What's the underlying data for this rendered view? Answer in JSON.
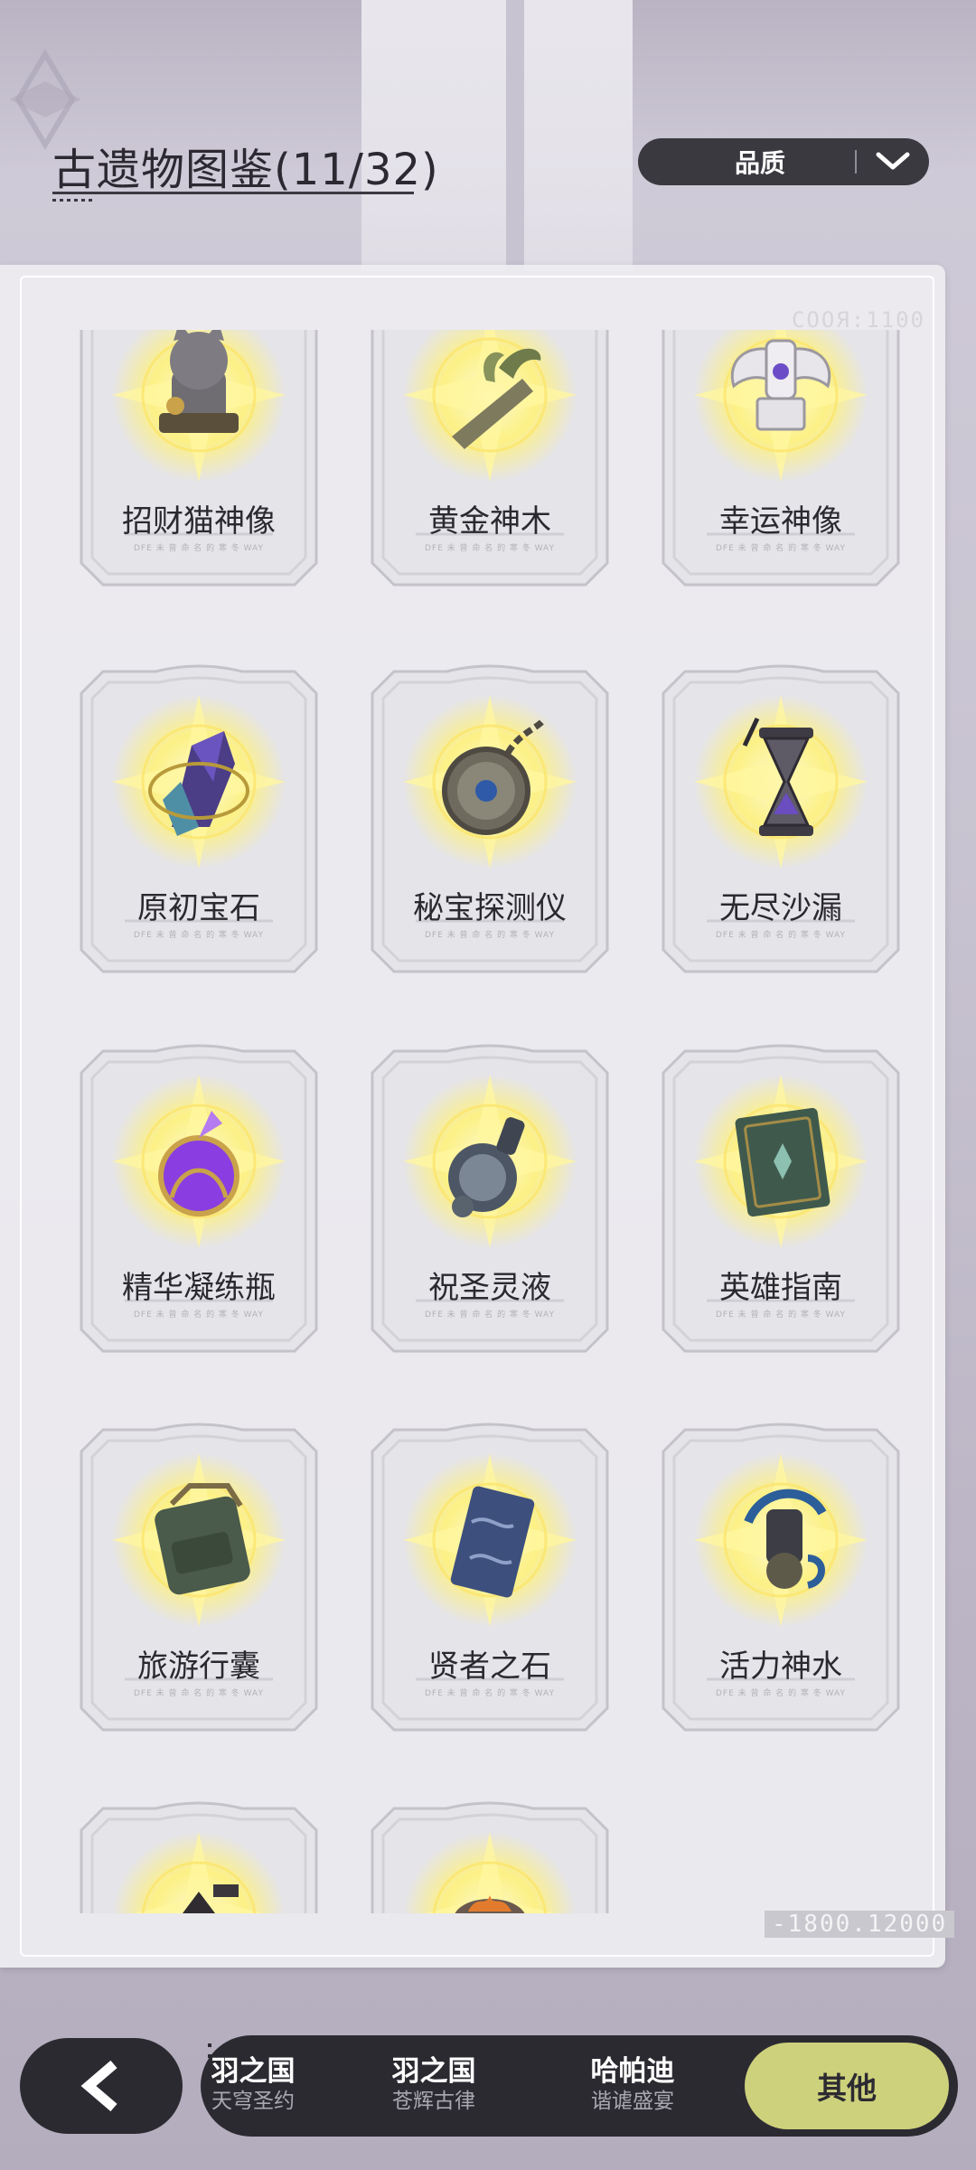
{
  "header": {
    "title": "古遗物图鉴(11/32)",
    "sort_label": "品质"
  },
  "panel": {
    "deco_top": "COOЯ:1100",
    "deco_bottom": "-1800.12000"
  },
  "relics": [
    {
      "name": "招财猫神像",
      "sub": "DFE 未 曾 命 名 的 寒 冬 WAY",
      "icon": "lucky-cat-statue-icon"
    },
    {
      "name": "黄金神木",
      "sub": "DFE 未 曾 命 名 的 寒 冬 WAY",
      "icon": "golden-branch-icon"
    },
    {
      "name": "幸运神像",
      "sub": "DFE 未 曾 命 名 的 寒 冬 WAY",
      "icon": "winged-idol-icon"
    },
    {
      "name": "原初宝石",
      "sub": "DFE 未 曾 命 名 的 寒 冬 WAY",
      "icon": "primal-gem-icon"
    },
    {
      "name": "秘宝探测仪",
      "sub": "DFE 未 曾 命 名 的 寒 冬 WAY",
      "icon": "pocket-watch-icon"
    },
    {
      "name": "无尽沙漏",
      "sub": "DFE 未 曾 命 名 的 寒 冬 WAY",
      "icon": "hourglass-icon"
    },
    {
      "name": "精华凝练瓶",
      "sub": "DFE 未 曾 命 名 的 寒 冬 WAY",
      "icon": "potion-flask-icon"
    },
    {
      "name": "祝圣灵液",
      "sub": "DFE 未 曾 命 名 的 寒 冬 WAY",
      "icon": "holy-liquid-icon"
    },
    {
      "name": "英雄指南",
      "sub": "DFE 未 曾 命 名 的 寒 冬 WAY",
      "icon": "hero-book-icon"
    },
    {
      "name": "旅游行囊",
      "sub": "DFE 未 曾 命 名 的 寒 冬 WAY",
      "icon": "backpack-icon"
    },
    {
      "name": "贤者之石",
      "sub": "DFE 未 曾 命 名 的 寒 冬 WAY",
      "icon": "sage-stone-icon"
    },
    {
      "name": "活力神水",
      "sub": "DFE 未 曾 命 名 的 寒 冬 WAY",
      "icon": "vitality-water-icon"
    },
    {
      "name": "",
      "sub": "",
      "icon": "dark-relic-icon"
    },
    {
      "name": "",
      "sub": "",
      "icon": "fire-pot-icon"
    }
  ],
  "nav": {
    "tabs": [
      {
        "title": "羽之国",
        "subtitle": "天穹圣约"
      },
      {
        "title": "羽之国",
        "subtitle": "苍辉古律"
      },
      {
        "title": "哈帕迪",
        "subtitle": "谐谑盛宴"
      }
    ],
    "active_tab": "其他"
  },
  "colors": {
    "accent": "#cdd17c",
    "dark": "#2c2a31",
    "glow": "#fff27a"
  }
}
